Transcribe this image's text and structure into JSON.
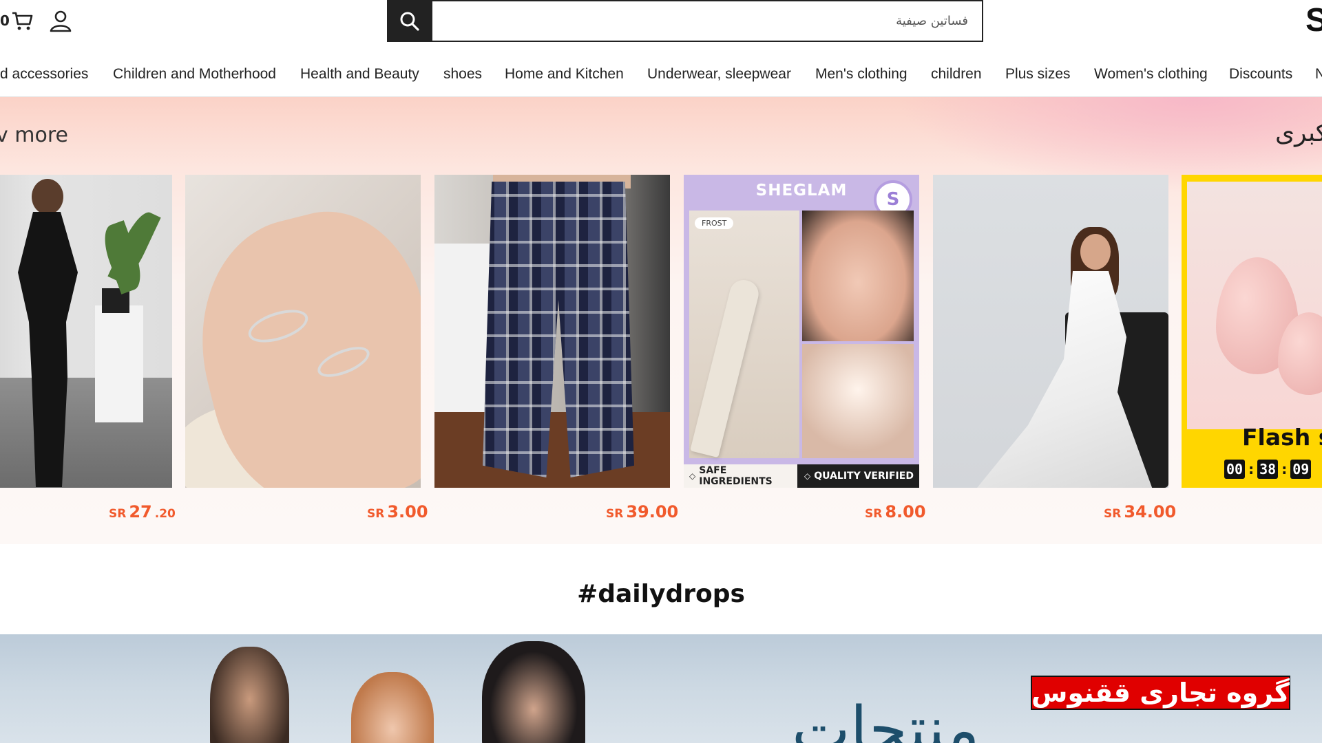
{
  "header": {
    "cart_count": "0",
    "search_placeholder": "فساتين صيفية",
    "brand_edge": "S"
  },
  "nav": {
    "items": [
      "d accessories",
      "Children and Motherhood",
      "Health and Beauty",
      "shoes",
      "Home and Kitchen",
      "Underwear, sleepwear",
      "Men's clothing",
      "children",
      "Plus sizes",
      "Women's clothing",
      "Discounts",
      "N"
    ]
  },
  "promo": {
    "view_more": "v more",
    "title": "كبرى",
    "products": [
      {
        "currency": "SR",
        "price": "27",
        "decimal": ".20"
      },
      {
        "currency": "SR",
        "price": "3.00"
      },
      {
        "currency": "SR",
        "price": "39.00"
      },
      {
        "currency": "SR",
        "price": "8.00",
        "brand": "SHEGLAM",
        "tag": "FROST",
        "badge_left": "SAFE INGREDIENTS",
        "badge_right": "QUALITY VERIFIED"
      },
      {
        "currency": "SR",
        "price": "34.00"
      },
      {
        "flash_label": "Flash sa",
        "timer": [
          "00",
          "38",
          "09"
        ]
      }
    ]
  },
  "daily_drops": {
    "title": "#dailydrops",
    "banner_text": "منتجات"
  },
  "watermark": "گروه تجاری ققنوس",
  "colors": {
    "price": "#f15a2c",
    "search_button": "#222222",
    "flash_bg": "#ffd600",
    "watermark_bg": "#e00000"
  }
}
